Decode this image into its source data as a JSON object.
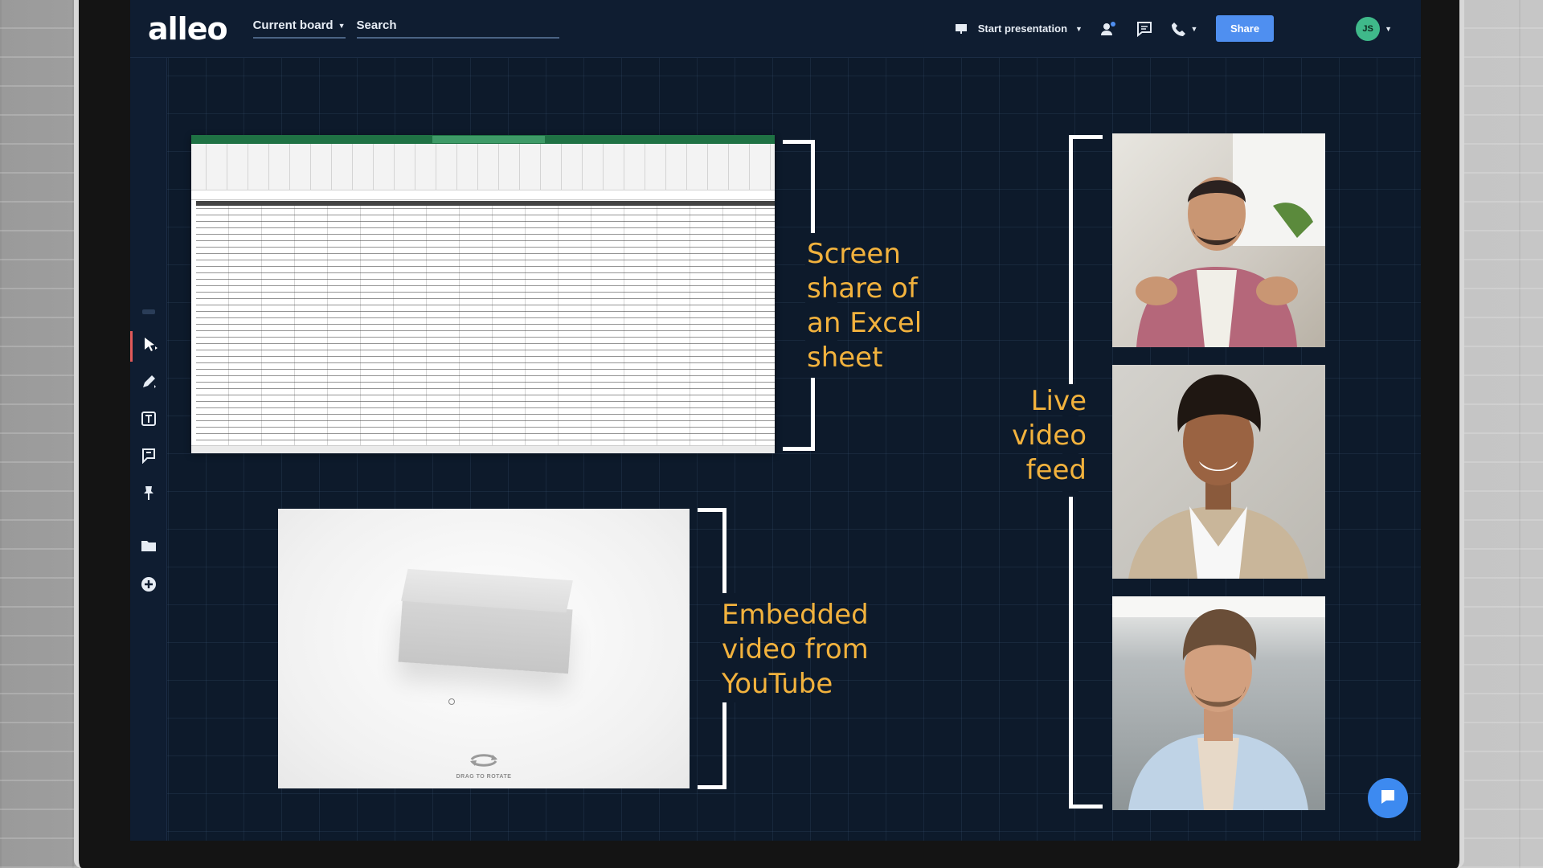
{
  "app": {
    "logo": "alleo",
    "board_select_label": "Current board",
    "search_placeholder": "Search",
    "start_presentation_label": "Start presentation",
    "share_label": "Share",
    "avatar_initials": "JS"
  },
  "toolbar": {
    "items": [
      {
        "name": "select-tool",
        "icon": "cursor-icon",
        "active": true
      },
      {
        "name": "pen-tool",
        "icon": "pen-icon",
        "active": false
      },
      {
        "name": "text-tool",
        "icon": "text-icon",
        "active": false
      },
      {
        "name": "sticky-note-tool",
        "icon": "comment-icon",
        "active": false
      },
      {
        "name": "pin-tool",
        "icon": "pin-icon",
        "active": false
      },
      {
        "name": "files-tool",
        "icon": "folder-icon",
        "active": false
      },
      {
        "name": "add-tool",
        "icon": "plus-circle-icon",
        "active": false
      }
    ]
  },
  "canvas": {
    "youtube_hint": "DRAG TO ROTATE",
    "annotations": {
      "excel": "Screen share of an Excel sheet",
      "excel_lines": [
        "Screen",
        "share of",
        "an Excel",
        "sheet"
      ],
      "video_feed_lines": [
        "Live",
        "video",
        "feed"
      ],
      "youtube_lines": [
        "Embedded",
        "video from",
        "YouTube"
      ]
    }
  },
  "colors": {
    "canvas_bg": "#0d1a2b",
    "annotation": "#f2b23d",
    "accent": "#4f8ff0",
    "excel_green": "#1f7244"
  }
}
